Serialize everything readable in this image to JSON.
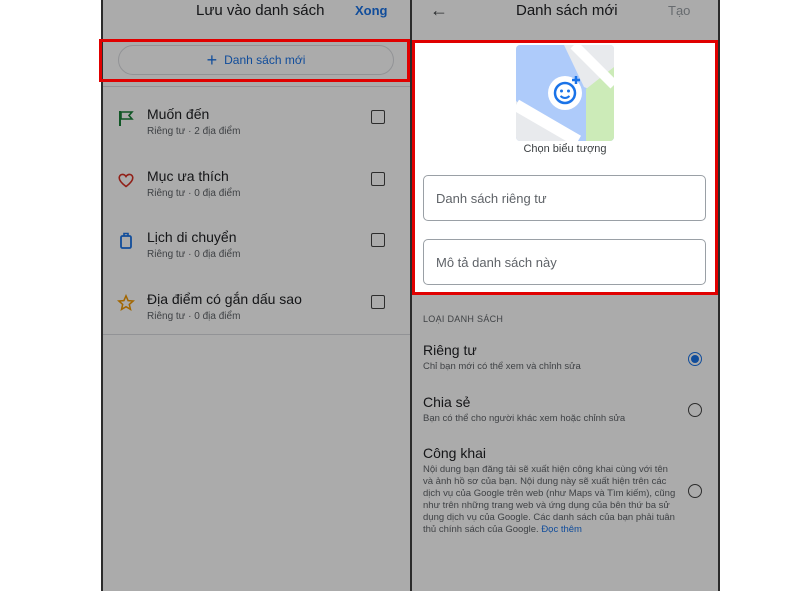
{
  "left_panel": {
    "title": "Lưu vào danh sách",
    "done_label": "Xong",
    "new_list_label": "Danh sách mới",
    "lists": [
      {
        "name": "Muốn đến",
        "meta": "Riêng tư · 2 địa điểm",
        "icon": "flag-icon",
        "icon_color": "#188038"
      },
      {
        "name": "Mục ưa thích",
        "meta": "Riêng tư · 0 địa điểm",
        "icon": "heart-icon",
        "icon_color": "#d93025"
      },
      {
        "name": "Lịch di chuyển",
        "meta": "Riêng tư · 0 địa điểm",
        "icon": "luggage-icon",
        "icon_color": "#1a73e8"
      },
      {
        "name": "Địa điểm có gắn dấu sao",
        "meta": "Riêng tư · 0 địa điểm",
        "icon": "star-icon",
        "icon_color": "#f29900"
      }
    ]
  },
  "right_panel": {
    "title": "Danh sách mới",
    "create_label": "Tạo",
    "choose_icon_label": "Chọn biểu tượng",
    "name_placeholder": "Danh sách riêng tư",
    "description_placeholder": "Mô tả danh sách này",
    "list_type_heading": "LOẠI DANH SÁCH",
    "options": [
      {
        "name": "Riêng tư",
        "desc": "Chỉ bạn mới có thể xem và chỉnh sửa",
        "selected": true
      },
      {
        "name": "Chia sẻ",
        "desc": "Bạn có thể cho người khác xem hoặc chỉnh sửa",
        "selected": false
      },
      {
        "name": "Công khai",
        "desc": "Nội dung bạn đăng tải sẽ xuất hiện công khai cùng với tên và ảnh hồ sơ của bạn. Nội dung này sẽ xuất hiện trên các dịch vụ của Google trên web (như Maps và Tìm kiếm), cũng như trên những trang web và ứng dụng của bên thứ ba sử dụng dịch vụ của Google. Các danh sách của bạn phải tuân thủ chính sách của Google.",
        "more_label": "Đọc thêm",
        "selected": false
      }
    ]
  },
  "colors": {
    "accent": "#1a73e8",
    "highlight": "#e00000"
  }
}
